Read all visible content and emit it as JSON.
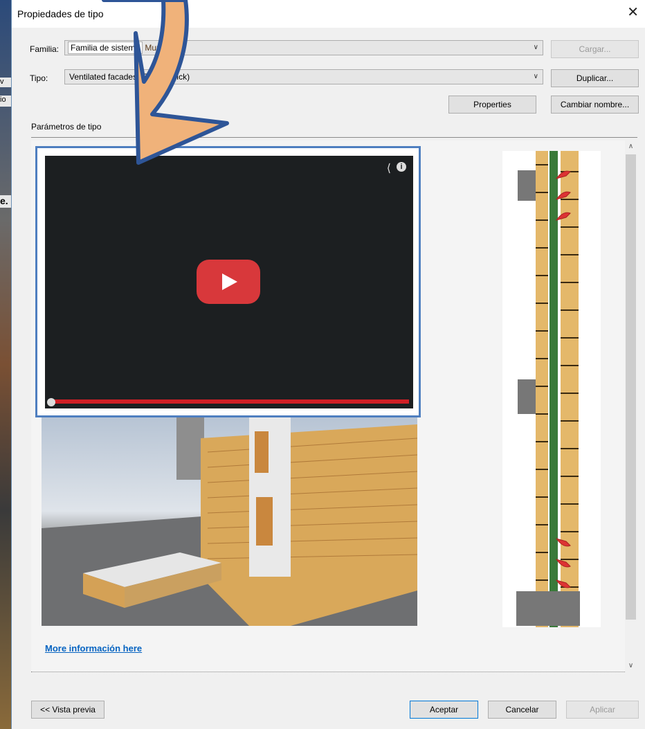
{
  "dialog": {
    "title": "Propiedades de tipo",
    "close_glyph": "✕"
  },
  "background_fragments": [
    "v",
    "io",
    "e."
  ],
  "family": {
    "label": "Familia:",
    "value_prefix": "Familia de sistema",
    "value_suffix": "Muro  /Wall"
  },
  "type": {
    "label": "Tipo:",
    "value": "Ventilated facades (Facing brick)"
  },
  "buttons": {
    "load": "Cargar...",
    "duplicate": "Duplicar...",
    "properties": "Properties",
    "rename": "Cambiar nombre...",
    "preview": "<< Vista previa",
    "ok": "Aceptar",
    "cancel": "Cancelar",
    "apply": "Aplicar"
  },
  "section": {
    "title": "Parámetros de tipo"
  },
  "content": {
    "link_text": "More información here"
  },
  "icons": {
    "arrow": "annotation-arrow-icon",
    "play": "play-button-icon",
    "share": "share-icon",
    "info": "info-icon"
  },
  "colors": {
    "annotation_arrow_fill": "#f0b27a",
    "annotation_arrow_stroke": "#2e5597",
    "video_border": "#4f7fc0",
    "play_button": "#d8383b",
    "progress_bar": "#d01f26",
    "link": "#0563c1"
  }
}
